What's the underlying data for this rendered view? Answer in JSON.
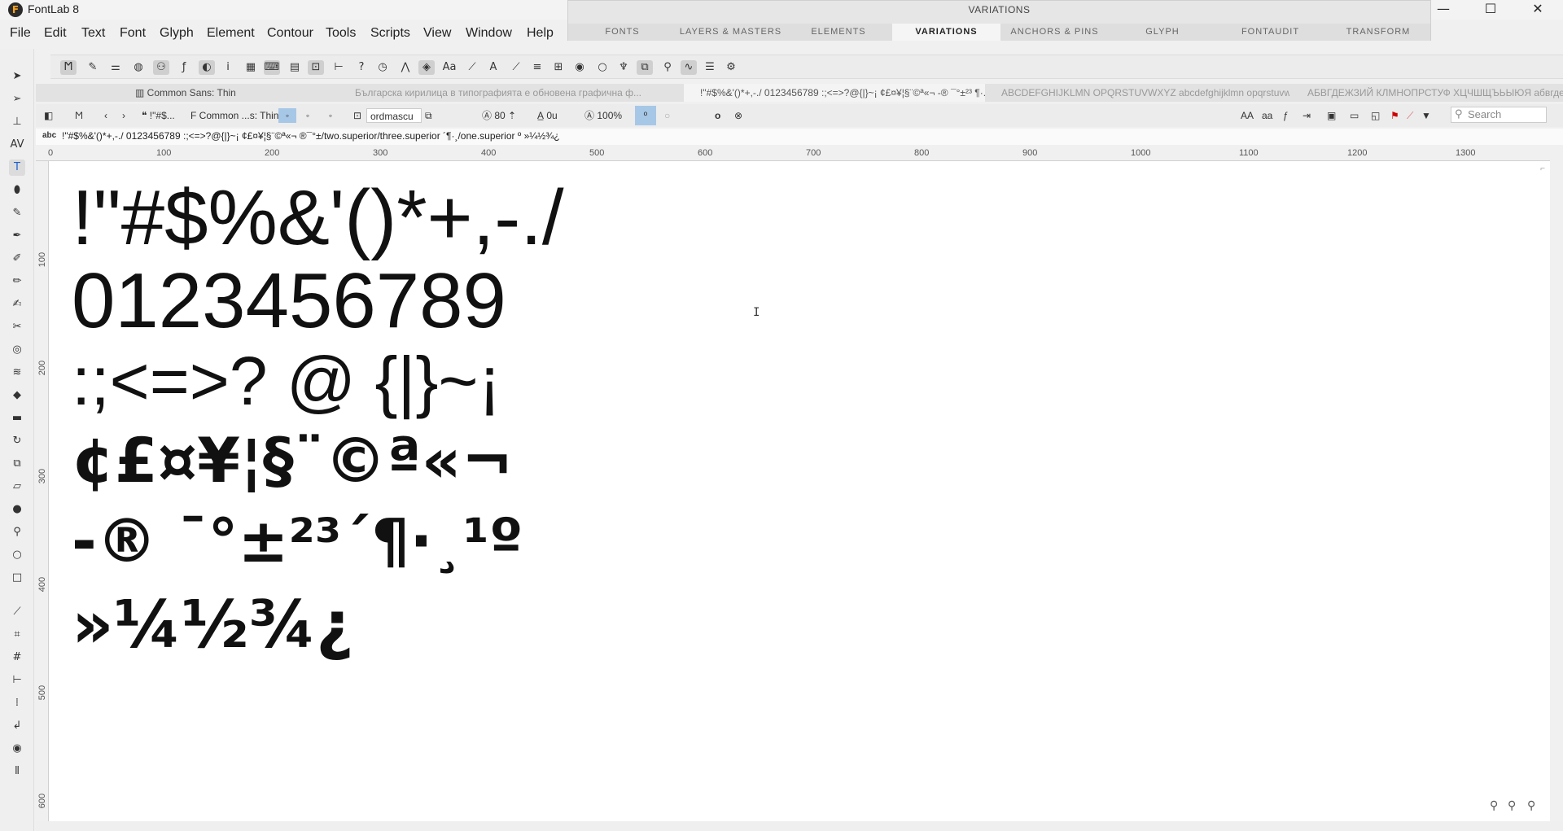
{
  "app": {
    "title": "FontLab 8",
    "logo_letter": "F"
  },
  "window_controls": {
    "minimize": "—",
    "maximize": "☐",
    "close": "✕"
  },
  "menu": [
    "File",
    "Edit",
    "Text",
    "Font",
    "Glyph",
    "Element",
    "Contour",
    "Tools",
    "Scripts",
    "View",
    "Window",
    "Help"
  ],
  "variations_panel": {
    "title": "VARIATIONS",
    "tabs": [
      "FONTS",
      "LAYERS & MASTERS",
      "ELEMENTS",
      "VARIATIONS",
      "ANCHORS & PINS",
      "GLYPH",
      "FONTAUDIT",
      "TRANSFORM"
    ],
    "active_tab": "VARIATIONS"
  },
  "document_tabs": [
    {
      "label": "Common Sans: Thin",
      "active": false
    },
    {
      "label": "Българска кирилица в типографията е обновена графична ф...",
      "active": false
    },
    {
      "label": "!\"#$%&'()*+,-./ 0123456789 :;<=>?@{|}~¡ ¢£¤¥¦§¨©ª«¬ -® ¯°±²³ ¶·...",
      "active": true
    },
    {
      "label": "ABCDEFGHIJKLMN OPQRSTUVWXYZ abcdefghijklmn opqrstuvw...",
      "active": false
    },
    {
      "label": "АБВГДЕЖЗИЙ КЛМНОПРСТУФ ХЦЧШЩЪЬЫЮЯ абвгдежз...",
      "active": false
    }
  ],
  "property_bar": {
    "text_label": "!\"#$...",
    "font_label": "Common ...s: Thin",
    "glyph_name": "ordmascu",
    "font_size": "80",
    "baseline": "0u",
    "zoom": "100%",
    "active_glyph": "º",
    "search_placeholder": "Search"
  },
  "text_bar": {
    "label": "abc",
    "content": "!\"#$%&'()*+,-./ 0123456789 :;<=>?@{|}~¡ ¢£¤¥¦§¨©ª«¬ ®¯°±/two.superior/three.superior ´¶·¸/one.superior º »¼½¾¿"
  },
  "ruler": {
    "h_ticks": [
      "0",
      "100",
      "200",
      "300",
      "400",
      "500",
      "600",
      "700",
      "800",
      "900",
      "1000",
      "1100",
      "1200",
      "1300"
    ],
    "v_ticks": [
      "100",
      "200",
      "300",
      "400",
      "500",
      "600"
    ]
  },
  "canvas_lines": [
    "!\"#$%&'()*+,-./",
    "0123456789",
    ":;<=>? @ {|}~¡",
    "¢£¤¥¦§¨©ª«¬",
    "-® ¯°±²³´¶·¸¹º",
    "»¼½¾¿"
  ],
  "toolbar_icons": [
    "font-mode",
    "brush",
    "sliders",
    "palette",
    "nodes",
    "serif-f",
    "contrast",
    "info",
    "grid",
    "kbd",
    "table",
    "id-box",
    "tree",
    "help",
    "clock",
    "kerning",
    "layers",
    "Aa",
    "ruler",
    "text-A",
    "knife",
    "align",
    "aaa",
    "eye",
    "lasso",
    "pen-nib",
    "transform",
    "pipette",
    "waves",
    "checklist",
    "settings"
  ]
}
